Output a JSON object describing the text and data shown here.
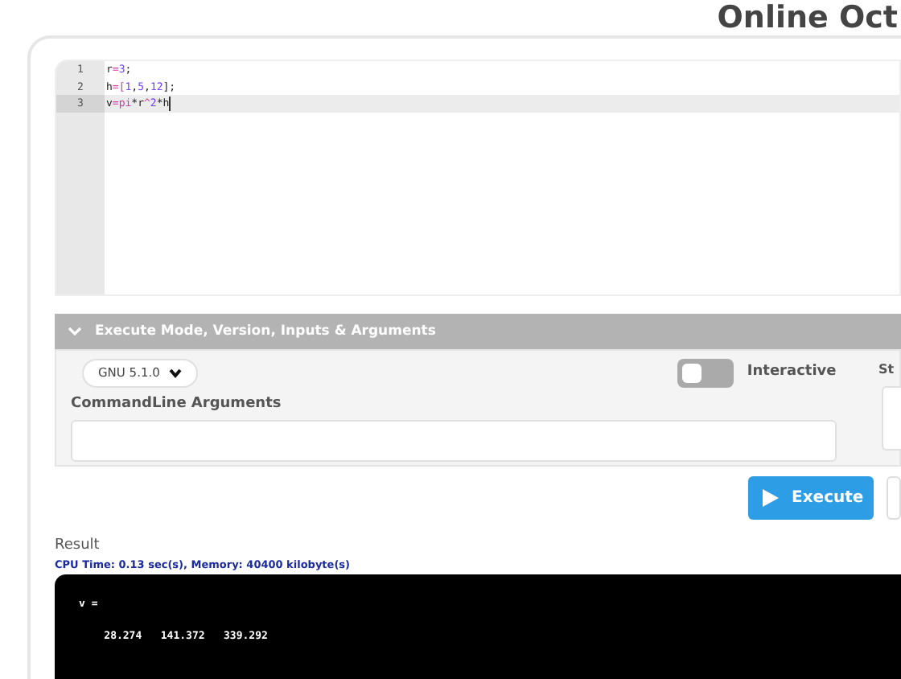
{
  "page_title": "Online Oct",
  "editor": {
    "lines": [
      {
        "number": "1",
        "active": false,
        "tokens": [
          {
            "kind": "plain",
            "text": "r"
          },
          {
            "kind": "op",
            "text": "="
          },
          {
            "kind": "num",
            "text": "3"
          },
          {
            "kind": "plain",
            "text": ";"
          }
        ]
      },
      {
        "number": "2",
        "active": false,
        "tokens": [
          {
            "kind": "plain",
            "text": "h"
          },
          {
            "kind": "op",
            "text": "=["
          },
          {
            "kind": "num",
            "text": "1"
          },
          {
            "kind": "plain",
            "text": ","
          },
          {
            "kind": "num",
            "text": "5"
          },
          {
            "kind": "plain",
            "text": ","
          },
          {
            "kind": "num",
            "text": "12"
          },
          {
            "kind": "plain",
            "text": "];"
          }
        ]
      },
      {
        "number": "3",
        "active": true,
        "tokens": [
          {
            "kind": "plain",
            "text": "v"
          },
          {
            "kind": "op",
            "text": "="
          },
          {
            "kind": "kw",
            "text": "pi"
          },
          {
            "kind": "plain",
            "text": "*r"
          },
          {
            "kind": "op",
            "text": "^"
          },
          {
            "kind": "num",
            "text": "2"
          },
          {
            "kind": "plain",
            "text": "*h"
          }
        ]
      }
    ]
  },
  "options_panel": {
    "title": "Execute Mode, Version, Inputs & Arguments",
    "expanded": true,
    "version": "GNU 5.1.0",
    "interactive": {
      "label": "Interactive",
      "on": false
    },
    "args_label": "CommandLine Arguments",
    "side_label": "St"
  },
  "execute_button": "Execute",
  "result": {
    "label": "Result",
    "stats": "CPU Time: 0.13 sec(s), Memory: 40400 kilobyte(s)",
    "output": [
      "v =",
      "    28.274   141.372   339.292"
    ]
  }
}
